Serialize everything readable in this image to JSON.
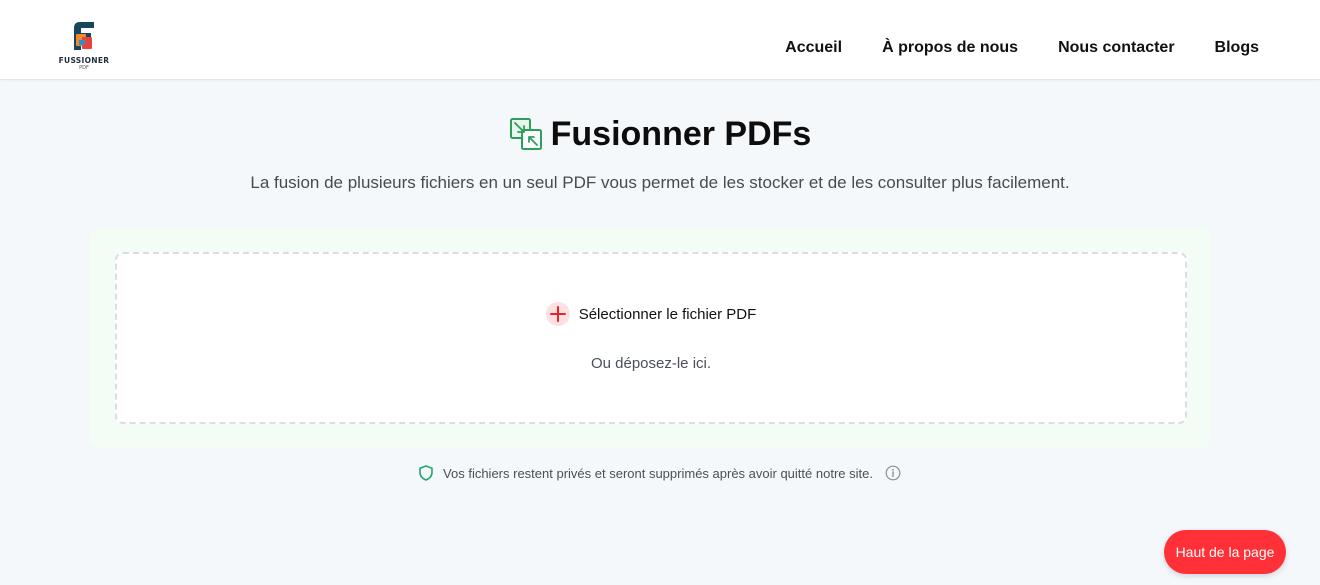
{
  "header": {
    "logo_text": "FUSSIONER",
    "logo_sub": "PDF",
    "nav": [
      "Accueil",
      "À propos de nous",
      "Nous contacter",
      "Blogs"
    ]
  },
  "main": {
    "title": "Fusionner PDFs",
    "subtitle": "La fusion de plusieurs fichiers en un seul PDF vous permet de les stocker et de les consulter plus facilement.",
    "title_icon": "merge-icon"
  },
  "upload": {
    "select_label": "Sélectionner le fichier PDF",
    "drop_hint": "Ou déposez-le ici."
  },
  "privacy": {
    "text": "Vos fichiers restent privés et seront supprimés après avoir quitté notre site."
  },
  "back_to_top": "Haut de la page",
  "colors": {
    "accent": "#ff3037",
    "icon_green": "#2e9e5b",
    "panel_bg": "#f3fcf5"
  }
}
